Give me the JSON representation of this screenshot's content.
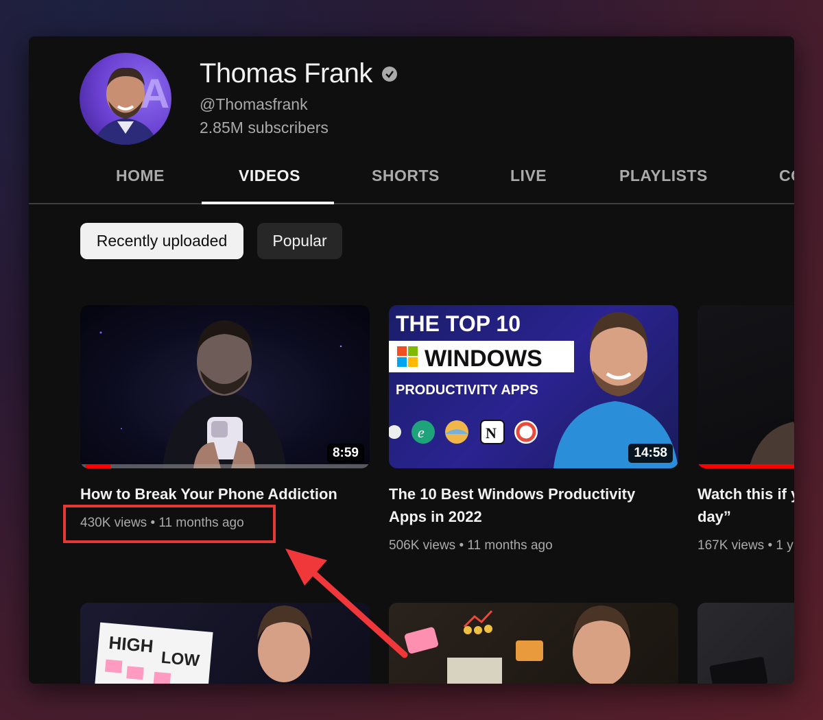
{
  "channel": {
    "name": "Thomas Frank",
    "handle": "@Thomasfrank",
    "subscribers": "2.85M subscribers"
  },
  "tabs": [
    {
      "label": "HOME",
      "active": false
    },
    {
      "label": "VIDEOS",
      "active": true
    },
    {
      "label": "SHORTS",
      "active": false
    },
    {
      "label": "LIVE",
      "active": false
    },
    {
      "label": "PLAYLISTS",
      "active": false
    },
    {
      "label": "CO",
      "active": false
    }
  ],
  "filters": {
    "selected": "Recently uploaded",
    "other": "Popular"
  },
  "videos": [
    {
      "title": "How to Break Your Phone Addiction",
      "meta": "430K views • 11 months ago",
      "duration": "8:59",
      "progress": 0.1
    },
    {
      "title": "The 10 Best Windows Productivity Apps in 2022",
      "meta": "506K views • 11 months ago",
      "duration": "14:58",
      "thumb_text": {
        "line1": "THE TOP 10",
        "line2": "WINDOWS",
        "line3": "PRODUCTIVITY APPS"
      }
    },
    {
      "title": "Watch this if y day”",
      "title_line1": "Watch this if y",
      "title_line2": "day”",
      "meta": "167K views • 1 y",
      "progress": 1.0
    }
  ],
  "row2_thumbs": {
    "sticky_words": [
      "HIGH",
      "LOW"
    ]
  },
  "annotation": {
    "color": "#e53935"
  },
  "colors": {
    "accent": "#ff0000",
    "background": "#0f0f0f",
    "text": "#f1f1f1",
    "muted": "#aaaaaa"
  }
}
